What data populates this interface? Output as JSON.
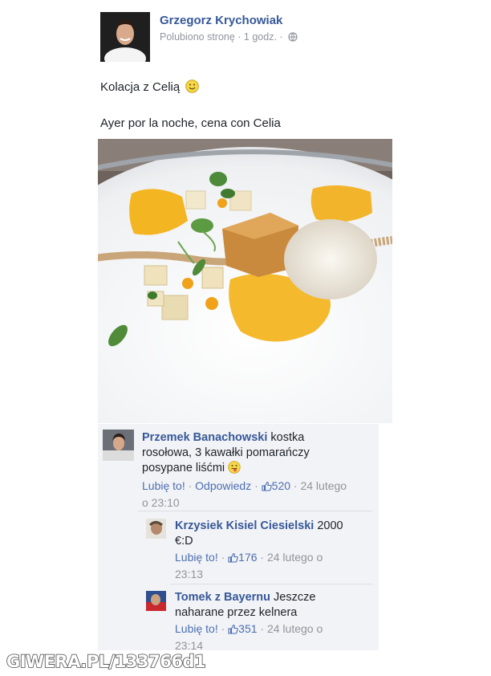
{
  "post": {
    "author": "Grzegorz Krychowiak",
    "meta": "Polubiono stronę · 1 godz. ·",
    "globe_icon": "globe-icon",
    "text_pl": "Kolacja z Celią",
    "smile_icon": "smile-emoji",
    "text_es": "Ayer por la noche, cena con Celia",
    "photo_icon": "food-plate-photo"
  },
  "comments": [
    {
      "name": "Przemek Banachowski",
      "text_1": " kostka",
      "text_2": "rosołowa, 3 kawałki pomarańczy",
      "text_3": "posypane liśćmi",
      "emoji": "tongue-emoji",
      "like_label": "Lubię to!",
      "sep_1": " · ",
      "reply_label": "Odpowiedz",
      "sep_2": " · ",
      "likes": "520",
      "time_1": " · 24 lutego",
      "time_2": "o 23:10"
    },
    {
      "name": "Krzysiek Kisiel Ciesielski",
      "text_1": " 2000",
      "text_2": "€:D",
      "like_label": "Lubię to!",
      "sep_1": " · ",
      "likes": "176",
      "time_1": " · 24 lutego o",
      "time_2": "23:13"
    },
    {
      "name": "Tomek z Bayernu",
      "text_1": " Jeszcze",
      "text_2": "naharane przez kelnera",
      "like_label": "Lubię to!",
      "sep_1": " · ",
      "likes": "351",
      "time_1": " · 24 lutego o",
      "time_2": "23:14"
    }
  ],
  "watermark": "GIWERA.PL/133766d1",
  "colors": {
    "link": "#365899",
    "meta": "#90949c",
    "comment_bg": "#f2f3f6"
  }
}
